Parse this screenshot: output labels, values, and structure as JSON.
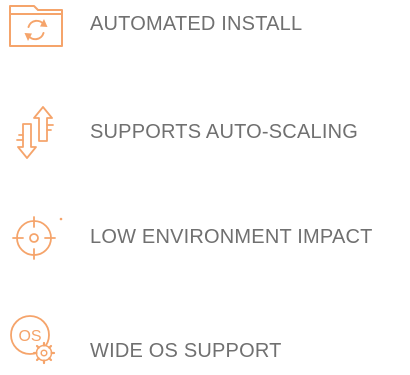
{
  "accent_color": "#F5A46B",
  "text_color": "#707070",
  "features": [
    {
      "icon": "folder-refresh-icon",
      "label": "AUTOMATED INSTALL"
    },
    {
      "icon": "scaling-arrows-icon",
      "label": "SUPPORTS AUTO-SCALING"
    },
    {
      "icon": "target-crosshair-icon",
      "label": "LOW ENVIRONMENT IMPACT"
    },
    {
      "icon": "os-gear-icon",
      "label": "WIDE OS SUPPORT",
      "icon_text": "OS"
    }
  ]
}
